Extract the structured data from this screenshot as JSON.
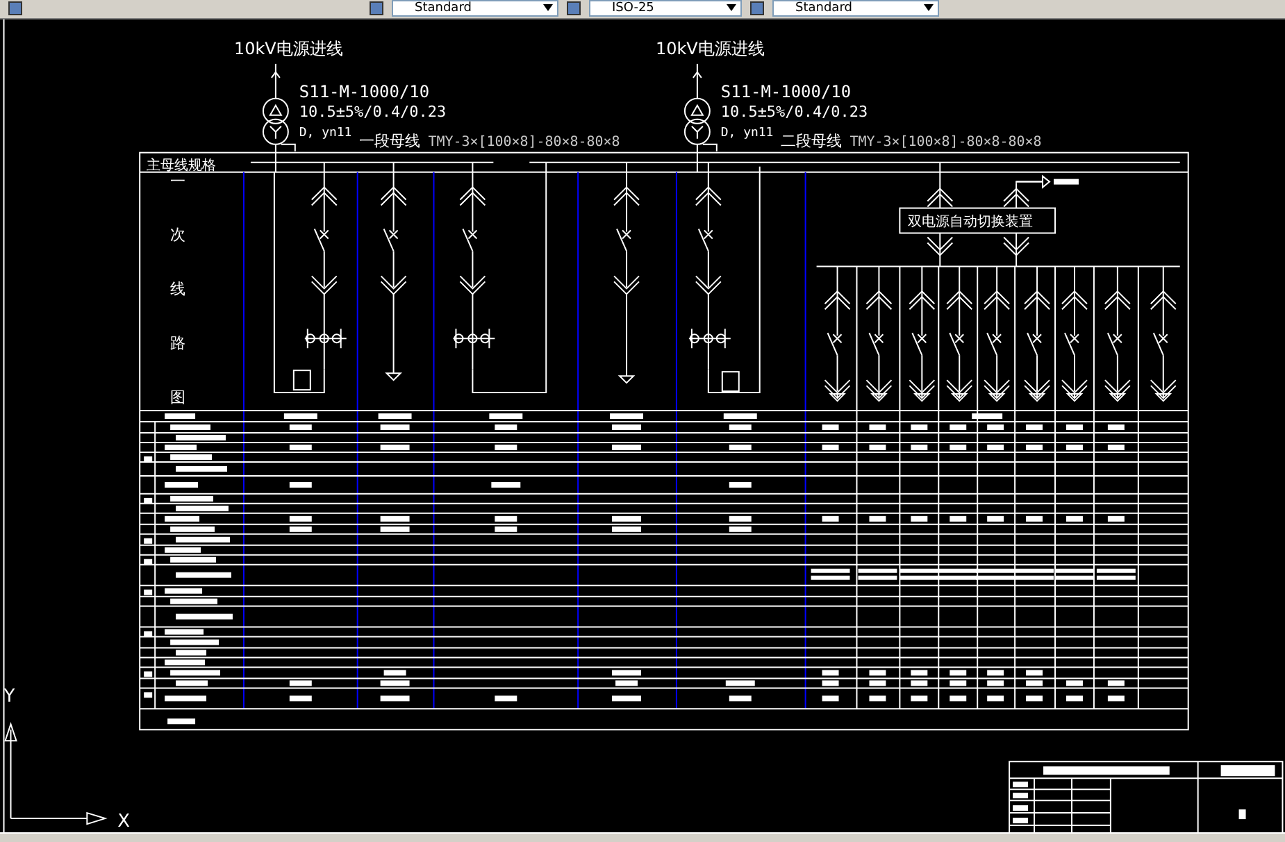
{
  "toolbar": {
    "dropdowns": [
      "Standard",
      "ISO-25",
      "Standard"
    ]
  },
  "drawing": {
    "feeders": [
      {
        "title": "10kV电源进线",
        "transformer": "S11-M-1000/10",
        "ratio": "10.5±5%/0.4/0.23",
        "vector_group": "D, yn11",
        "busbar_label": "一段母线",
        "busbar_spec": "TMY-3×[100×8]-80×8-80×8"
      },
      {
        "title": "10kV电源进线",
        "transformer": "S11-M-1000/10",
        "ratio": "10.5±5%/0.4/0.23",
        "vector_group": "D, yn11",
        "busbar_label": "二段母线",
        "busbar_spec": "TMY-3×[100×8]-80×8-80×8"
      }
    ],
    "table_header": "主母线规格",
    "row_title_chars": [
      "一",
      "次",
      "线",
      "路",
      "图"
    ],
    "ats_label": "双电源自动切换装置"
  },
  "ucs": {
    "x_label": "X",
    "y_label": "Y"
  }
}
